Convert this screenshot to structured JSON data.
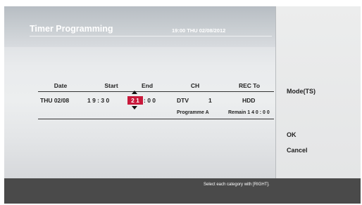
{
  "header": {
    "title": "Timer Programming",
    "clock": "19:00  THU  02/08/2012"
  },
  "table": {
    "headers": {
      "date": "Date",
      "start": "Start",
      "end": "End",
      "ch": "CH",
      "rec_to": "REC To"
    },
    "row": {
      "date": "THU 02/08",
      "start": "1 9  :  3 0",
      "end_hour": "2 1",
      "end_rest": ":  0 0",
      "ch_type": "DTV",
      "ch_number": "1",
      "rec_to": "HDD",
      "programme": "Programme A",
      "remain": "Remain  1 4 0 : 0 0"
    }
  },
  "side_menu": {
    "mode": "Mode(TS)",
    "ok": "OK",
    "cancel": "Cancel"
  },
  "footer": {
    "hint": "Select each category with [RIGHT]."
  },
  "colors": {
    "highlight": "#c8193b",
    "footer_bar": "#4a4a4a"
  }
}
